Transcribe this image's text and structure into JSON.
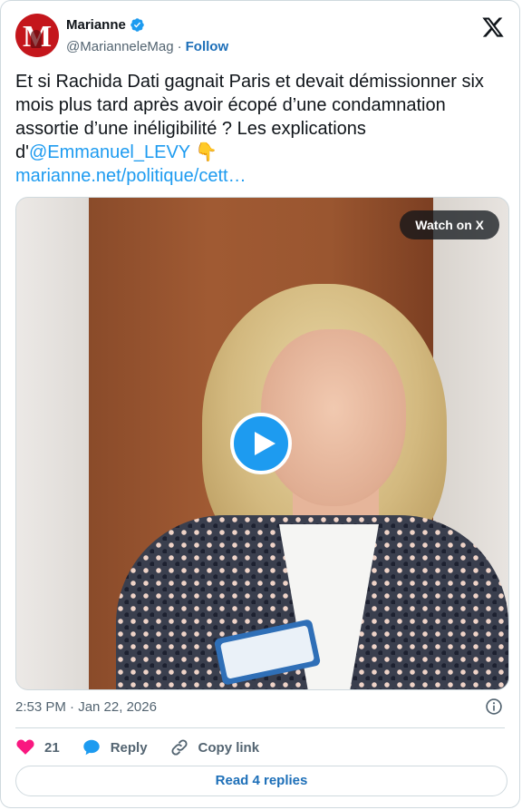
{
  "account": {
    "name": "Marianne",
    "handle": "@MarianneleMag",
    "separator": "·",
    "follow_label": "Follow",
    "avatar_letter": "M",
    "verified": true
  },
  "tweet": {
    "text_main": "Et si Rachida Dati gagnait Paris et devait démissionner six mois plus tard après avoir écopé d’une condamnation assortie d’une inéligibilité ? Les explications d'",
    "mention": "@Emmanuel_LEVY",
    "emoji": "👇",
    "link": "marianne.net/politique/cett…"
  },
  "media": {
    "watch_label": "Watch on X"
  },
  "timestamp": "2:53 PM · Jan 22, 2026",
  "actions": {
    "likes": "21",
    "reply_label": "Reply",
    "copy_link_label": "Copy link"
  },
  "read_replies_label": "Read 4 replies",
  "colors": {
    "accent": "#1d9bf0",
    "like": "#f91880",
    "text": "#0f1419",
    "muted": "#536471"
  }
}
